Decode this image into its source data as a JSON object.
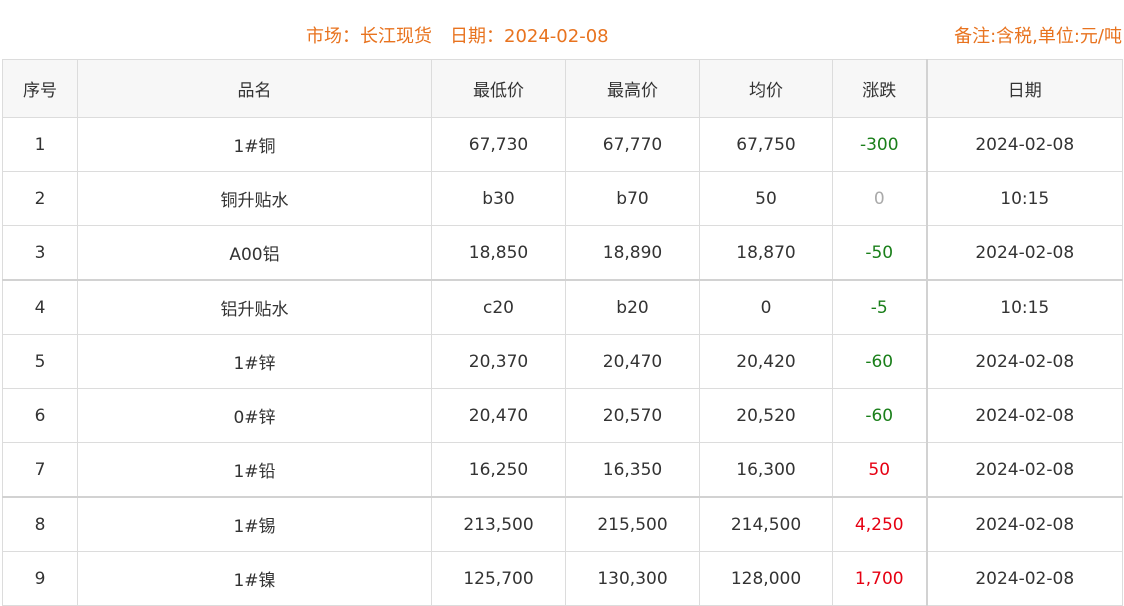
{
  "header": {
    "market_label": "市场：",
    "market_value": "长江现货",
    "date_label": "日期：",
    "date_value": "2024-02-08",
    "note": "备注:含税,单位:元/吨"
  },
  "table": {
    "columns": [
      "序号",
      "品名",
      "最低价",
      "最高价",
      "均价",
      "涨跌",
      "日期"
    ],
    "rows": [
      {
        "no": "1",
        "name": "1#铜",
        "low": "67,730",
        "high": "67,770",
        "avg": "67,750",
        "change": "-300",
        "trend": "down",
        "date": "2024-02-08"
      },
      {
        "no": "2",
        "name": "铜升贴水",
        "low": "b30",
        "high": "b70",
        "avg": "50",
        "change": "0",
        "trend": "flat",
        "date": "10:15"
      },
      {
        "no": "3",
        "name": "A00铝",
        "low": "18,850",
        "high": "18,890",
        "avg": "18,870",
        "change": "-50",
        "trend": "down",
        "date": "2024-02-08"
      },
      {
        "no": "4",
        "name": "铝升贴水",
        "low": "c20",
        "high": "b20",
        "avg": "0",
        "change": "-5",
        "trend": "down",
        "date": "10:15"
      },
      {
        "no": "5",
        "name": "1#锌",
        "low": "20,370",
        "high": "20,470",
        "avg": "20,420",
        "change": "-60",
        "trend": "down",
        "date": "2024-02-08"
      },
      {
        "no": "6",
        "name": "0#锌",
        "low": "20,470",
        "high": "20,570",
        "avg": "20,520",
        "change": "-60",
        "trend": "down",
        "date": "2024-02-08"
      },
      {
        "no": "7",
        "name": "1#铅",
        "low": "16,250",
        "high": "16,350",
        "avg": "16,300",
        "change": "50",
        "trend": "up",
        "date": "2024-02-08"
      },
      {
        "no": "8",
        "name": "1#锡",
        "low": "213,500",
        "high": "215,500",
        "avg": "214,500",
        "change": "4,250",
        "trend": "up",
        "date": "2024-02-08"
      },
      {
        "no": "9",
        "name": "1#镍",
        "low": "125,700",
        "high": "130,300",
        "avg": "128,000",
        "change": "1,700",
        "trend": "up",
        "date": "2024-02-08"
      }
    ]
  },
  "colors": {
    "header_accent": "#e8731f",
    "change_down": "#1a7f1a",
    "change_up": "#e60012",
    "change_flat": "#aaaaaa"
  }
}
